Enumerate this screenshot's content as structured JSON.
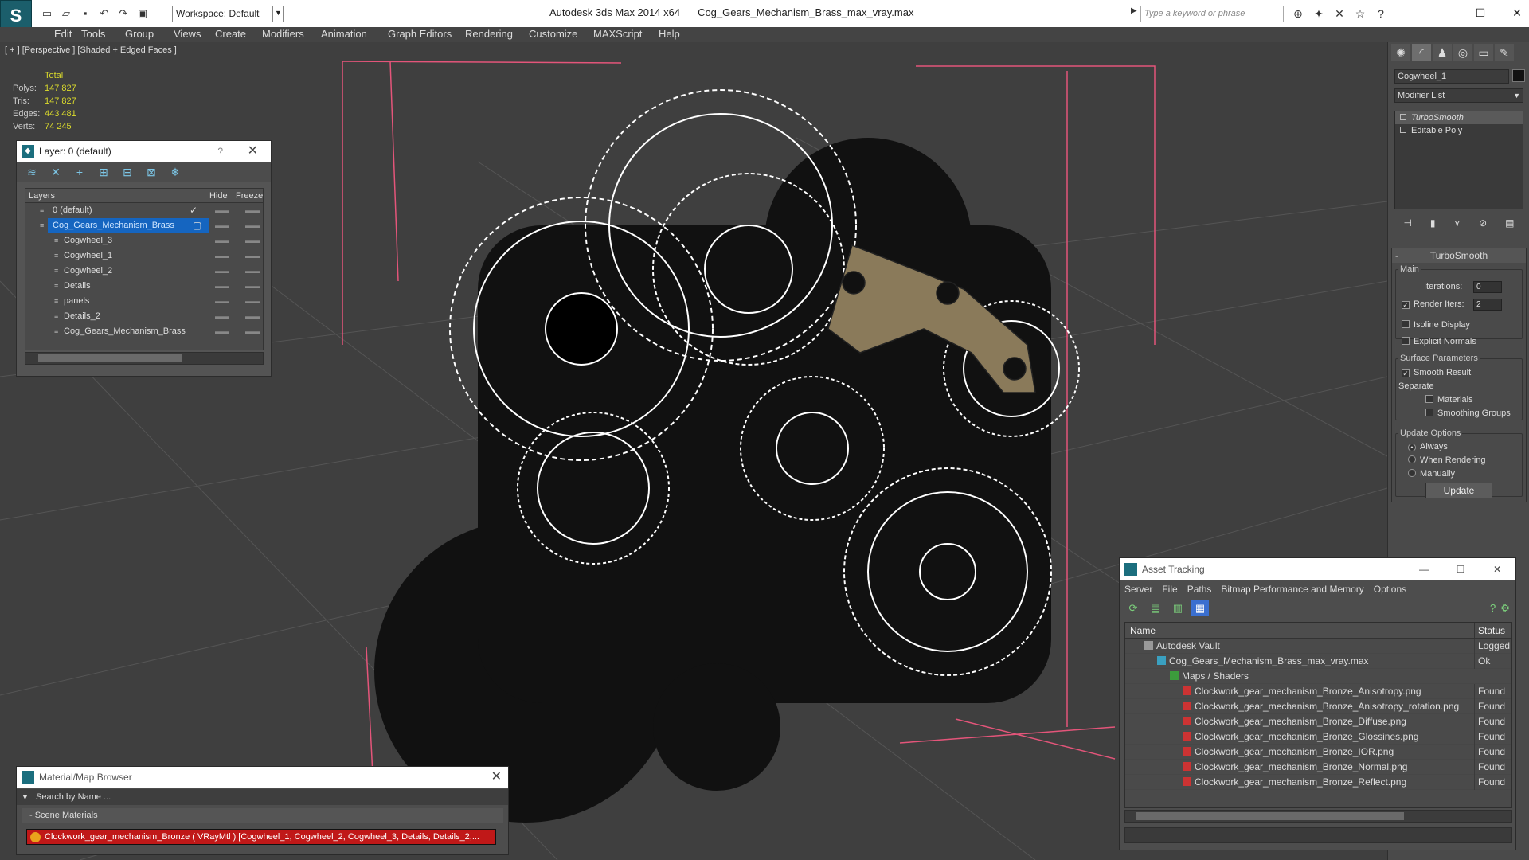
{
  "titlebar": {
    "app": "Autodesk 3ds Max  2014 x64",
    "file": "Cog_Gears_Mechanism_Brass_max_vray.max",
    "workspace": "Workspace: Default",
    "search_placeholder": "Type a keyword or phrase",
    "logo": "S"
  },
  "menu": [
    "Edit",
    "Tools",
    "Group",
    "Views",
    "Create",
    "Modifiers",
    "Animation",
    "Graph Editors",
    "Rendering",
    "Customize",
    "MAXScript",
    "Help"
  ],
  "viewport": {
    "label": "[ + ] [Perspective ] [Shaded + Edged Faces ]",
    "stats": {
      "total_label": "Total",
      "polys_label": "Polys:",
      "polys": "147 827",
      "tris_label": "Tris:",
      "tris": "147 827",
      "edges_label": "Edges:",
      "edges": "443 481",
      "verts_label": "Verts:",
      "verts": "74 245"
    }
  },
  "layer_panel": {
    "title": "Layer: 0 (default)",
    "help": "?",
    "col_layers": "Layers",
    "col_hide": "Hide",
    "col_freeze": "Freeze",
    "rows": [
      {
        "name": "0 (default)",
        "indent": 0
      },
      {
        "name": "Cog_Gears_Mechanism_Brass",
        "indent": 0
      },
      {
        "name": "Cogwheel_3",
        "indent": 1
      },
      {
        "name": "Cogwheel_1",
        "indent": 1
      },
      {
        "name": "Cogwheel_2",
        "indent": 1
      },
      {
        "name": "Details",
        "indent": 1
      },
      {
        "name": "panels",
        "indent": 1
      },
      {
        "name": "Details_2",
        "indent": 1
      },
      {
        "name": "Cog_Gears_Mechanism_Brass",
        "indent": 1
      }
    ]
  },
  "command_panel": {
    "object_name": "Cogwheel_1",
    "modifier_list": "Modifier List",
    "stack": [
      "TurboSmooth",
      "Editable Poly"
    ],
    "rollout_title": "TurboSmooth",
    "main_label": "Main",
    "iterations_label": "Iterations:",
    "iterations": "0",
    "render_iters_label": "Render Iters:",
    "render_iters": "2",
    "isoline": "Isoline Display",
    "explicit": "Explicit Normals",
    "surface_label": "Surface Parameters",
    "smooth_result": "Smooth Result",
    "separate_label": "Separate",
    "materials": "Materials",
    "smoothing_groups": "Smoothing Groups",
    "update_options": "Update Options",
    "always": "Always",
    "when_rendering": "When Rendering",
    "manually": "Manually",
    "update_btn": "Update"
  },
  "asset_tracking": {
    "title": "Asset Tracking",
    "menu": [
      "Server",
      "File",
      "Paths",
      "Bitmap Performance and Memory",
      "Options"
    ],
    "col_name": "Name",
    "col_status": "Status",
    "rows": [
      {
        "name": "Autodesk Vault",
        "status": "Logged Ou",
        "indent": 1,
        "icon": "vault"
      },
      {
        "name": "Cog_Gears_Mechanism_Brass_max_vray.max",
        "status": "Ok",
        "indent": 2,
        "icon": "max"
      },
      {
        "name": "Maps / Shaders",
        "status": "",
        "indent": 3,
        "icon": "folder"
      },
      {
        "name": "Clockwork_gear_mechanism_Bronze_Anisotropy.png",
        "status": "Found",
        "indent": 4,
        "icon": "png"
      },
      {
        "name": "Clockwork_gear_mechanism_Bronze_Anisotropy_rotation.png",
        "status": "Found",
        "indent": 4,
        "icon": "png"
      },
      {
        "name": "Clockwork_gear_mechanism_Bronze_Diffuse.png",
        "status": "Found",
        "indent": 4,
        "icon": "png"
      },
      {
        "name": "Clockwork_gear_mechanism_Bronze_Glossines.png",
        "status": "Found",
        "indent": 4,
        "icon": "png"
      },
      {
        "name": "Clockwork_gear_mechanism_Bronze_IOR.png",
        "status": "Found",
        "indent": 4,
        "icon": "png"
      },
      {
        "name": "Clockwork_gear_mechanism_Bronze_Normal.png",
        "status": "Found",
        "indent": 4,
        "icon": "png"
      },
      {
        "name": "Clockwork_gear_mechanism_Bronze_Reflect.png",
        "status": "Found",
        "indent": 4,
        "icon": "png"
      }
    ]
  },
  "material_browser": {
    "title": "Material/Map Browser",
    "search": "Search by Name ...",
    "group": "- Scene Materials",
    "item": "Clockwork_gear_mechanism_Bronze  ( VRayMtl ) [Cogwheel_1, Cogwheel_2, Cogwheel_3, Details, Details_2,..."
  },
  "colors": {
    "accent": "#1565c0",
    "material_highlight": "#c01818",
    "stat_yellow": "#d9d92c"
  }
}
